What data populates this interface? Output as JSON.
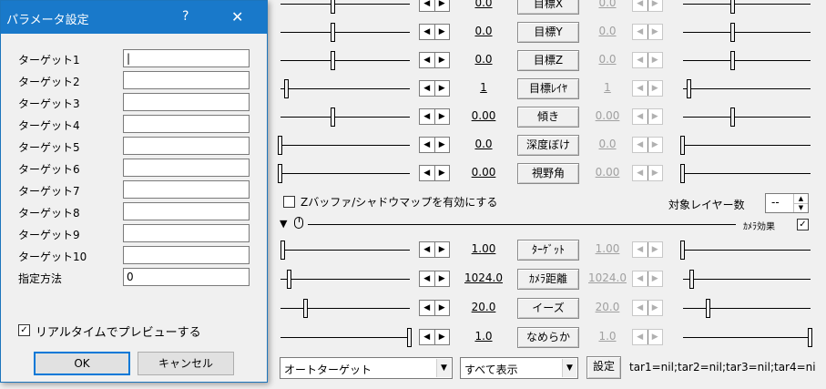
{
  "dialog": {
    "title": "パラメータ設定",
    "help_glyph": "?",
    "close_glyph": "✕",
    "fields": [
      {
        "label": "ターゲット1",
        "value": "|"
      },
      {
        "label": "ターゲット2",
        "value": ""
      },
      {
        "label": "ターゲット3",
        "value": ""
      },
      {
        "label": "ターゲット4",
        "value": ""
      },
      {
        "label": "ターゲット5",
        "value": ""
      },
      {
        "label": "ターゲット6",
        "value": ""
      },
      {
        "label": "ターゲット7",
        "value": ""
      },
      {
        "label": "ターゲット8",
        "value": ""
      },
      {
        "label": "ターゲット9",
        "value": ""
      },
      {
        "label": "ターゲット10",
        "value": ""
      },
      {
        "label": "指定方法",
        "value": "0"
      }
    ],
    "realtime_preview": {
      "label": "リアルタイムでプレビューする",
      "checked": true
    },
    "ok_label": "OK",
    "cancel_label": "キャンセル"
  },
  "panel": {
    "rows": [
      {
        "value": "0.0",
        "label": "目標X",
        "value2": "0.0",
        "enabled2": false,
        "level": 0.41,
        "level2": 0.39
      },
      {
        "value": "0.0",
        "label": "目標Y",
        "value2": "0.0",
        "enabled2": false,
        "level": 0.41,
        "level2": 0.39
      },
      {
        "value": "0.0",
        "label": "目標Z",
        "value2": "0.0",
        "enabled2": false,
        "level": 0.41,
        "level2": 0.39
      },
      {
        "value": "1",
        "label": "目標ﾚｲﾔ",
        "value2": "1",
        "enabled2": false,
        "level": 0.05,
        "level2": 0.05
      },
      {
        "value": "0.00",
        "label": "傾き",
        "value2": "0.00",
        "enabled2": false,
        "level": 0.41,
        "level2": 0.39
      },
      {
        "value": "0.0",
        "label": "深度ぼけ",
        "value2": "0.0",
        "enabled2": false,
        "level": 0.0,
        "level2": 0.0
      },
      {
        "value": "0.00",
        "label": "視野角",
        "value2": "0.00",
        "enabled2": false,
        "level": 0.0,
        "level2": 0.0
      }
    ],
    "zbuffer": {
      "label": "Zバッファ/シャドウマップを有効にする",
      "checked": false
    },
    "target_layer_count": {
      "label": "対象レイヤー数",
      "value": "--"
    },
    "effect_header": {
      "expand_glyph": "▼",
      "mouse_glyph": "🖱",
      "label": "ｶﾒﾗ効果",
      "checked": true
    },
    "effect_rows": [
      {
        "value": "1.00",
        "label": "ﾀｰｹﾞｯﾄ",
        "value2": "1.00",
        "enabled2": false,
        "level": 0.02,
        "level2": 0.0
      },
      {
        "value": "1024.0",
        "label": "ｶﾒﾗ距離",
        "value2": "1024.0",
        "enabled2": false,
        "level": 0.07,
        "level2": 0.07
      },
      {
        "value": "20.0",
        "label": "イーズ",
        "value2": "20.0",
        "enabled2": false,
        "level": 0.2,
        "level2": 0.2
      },
      {
        "value": "1.0",
        "label": "なめらか",
        "value2": "1.0",
        "enabled2": false,
        "level": 1.0,
        "level2": 1.0
      }
    ],
    "target_mode_select": "オートターゲット",
    "display_select": "すべて表示",
    "settings_label": "設定",
    "status_text": "tar1=nil;tar2=nil;tar3=nil;tar4=ni"
  },
  "colors": {
    "titlebar": "#1979ca",
    "accent": "#0078d7"
  }
}
